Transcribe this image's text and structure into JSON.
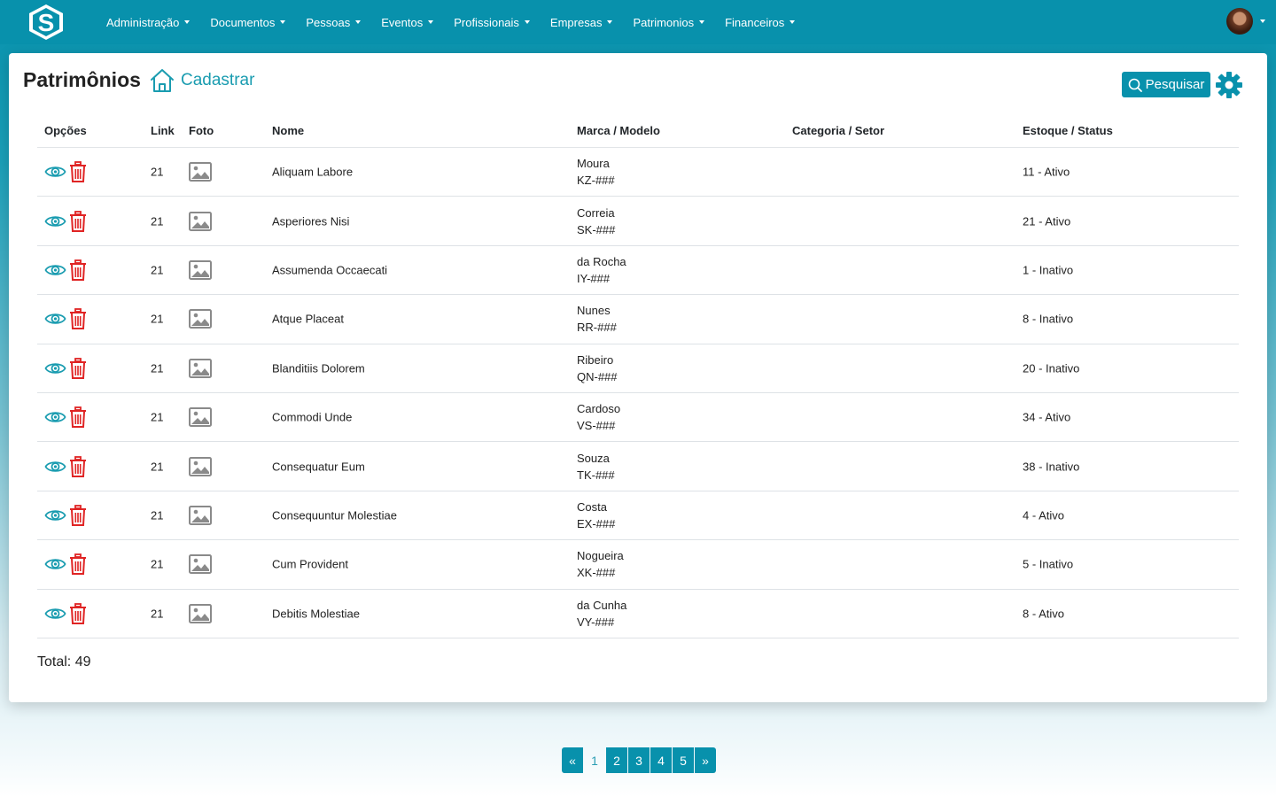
{
  "navbar": {
    "items": [
      {
        "label": "Administração"
      },
      {
        "label": "Documentos"
      },
      {
        "label": "Pessoas"
      },
      {
        "label": "Eventos"
      },
      {
        "label": "Profissionais"
      },
      {
        "label": "Empresas"
      },
      {
        "label": "Patrimonios"
      },
      {
        "label": "Financeiros"
      }
    ]
  },
  "page": {
    "title": "Patrimônios",
    "create_label": "Cadastrar",
    "search_label": "Pesquisar"
  },
  "table": {
    "headers": {
      "options": "Opções",
      "link": "Link",
      "photo": "Foto",
      "name": "Nome",
      "brand_model": "Marca / Modelo",
      "category_sector": "Categoria / Setor",
      "stock_status": "Estoque / Status"
    },
    "rows": [
      {
        "link": "21",
        "name": "Aliquam Labore",
        "brand": "Moura",
        "model": "KZ-###",
        "category": "",
        "stock_status": "11 - Ativo"
      },
      {
        "link": "21",
        "name": "Asperiores Nisi",
        "brand": "Correia",
        "model": "SK-###",
        "category": "",
        "stock_status": "21 - Ativo"
      },
      {
        "link": "21",
        "name": "Assumenda Occaecati",
        "brand": "da Rocha",
        "model": "IY-###",
        "category": "",
        "stock_status": "1 - Inativo"
      },
      {
        "link": "21",
        "name": "Atque Placeat",
        "brand": "Nunes",
        "model": "RR-###",
        "category": "",
        "stock_status": "8 - Inativo"
      },
      {
        "link": "21",
        "name": "Blanditiis Dolorem",
        "brand": "Ribeiro",
        "model": "QN-###",
        "category": "",
        "stock_status": "20 - Inativo"
      },
      {
        "link": "21",
        "name": "Commodi Unde",
        "brand": "Cardoso",
        "model": "VS-###",
        "category": "",
        "stock_status": "34 - Ativo"
      },
      {
        "link": "21",
        "name": "Consequatur Eum",
        "brand": "Souza",
        "model": "TK-###",
        "category": "",
        "stock_status": "38 - Inativo"
      },
      {
        "link": "21",
        "name": "Consequuntur Molestiae",
        "brand": "Costa",
        "model": "EX-###",
        "category": "",
        "stock_status": "4 - Ativo"
      },
      {
        "link": "21",
        "name": "Cum Provident",
        "brand": "Nogueira",
        "model": "XK-###",
        "category": "",
        "stock_status": "5 - Inativo"
      },
      {
        "link": "21",
        "name": "Debitis Molestiae",
        "brand": "da Cunha",
        "model": "VY-###",
        "category": "",
        "stock_status": "8 - Ativo"
      }
    ],
    "total_label": "Total: 49"
  },
  "pagination": {
    "prev": "«",
    "pages": [
      "1",
      "2",
      "3",
      "4",
      "5"
    ],
    "current": "1",
    "next": "»"
  },
  "colors": {
    "primary": "#0891ac",
    "eye": "#1a9cb0",
    "trash": "#e02424"
  },
  "icons": {
    "logo": "s-logo-icon",
    "home": "home-icon",
    "search": "search-icon",
    "settings": "gear-icon",
    "view": "eye-icon",
    "delete": "trash-icon",
    "photo": "image-icon"
  }
}
